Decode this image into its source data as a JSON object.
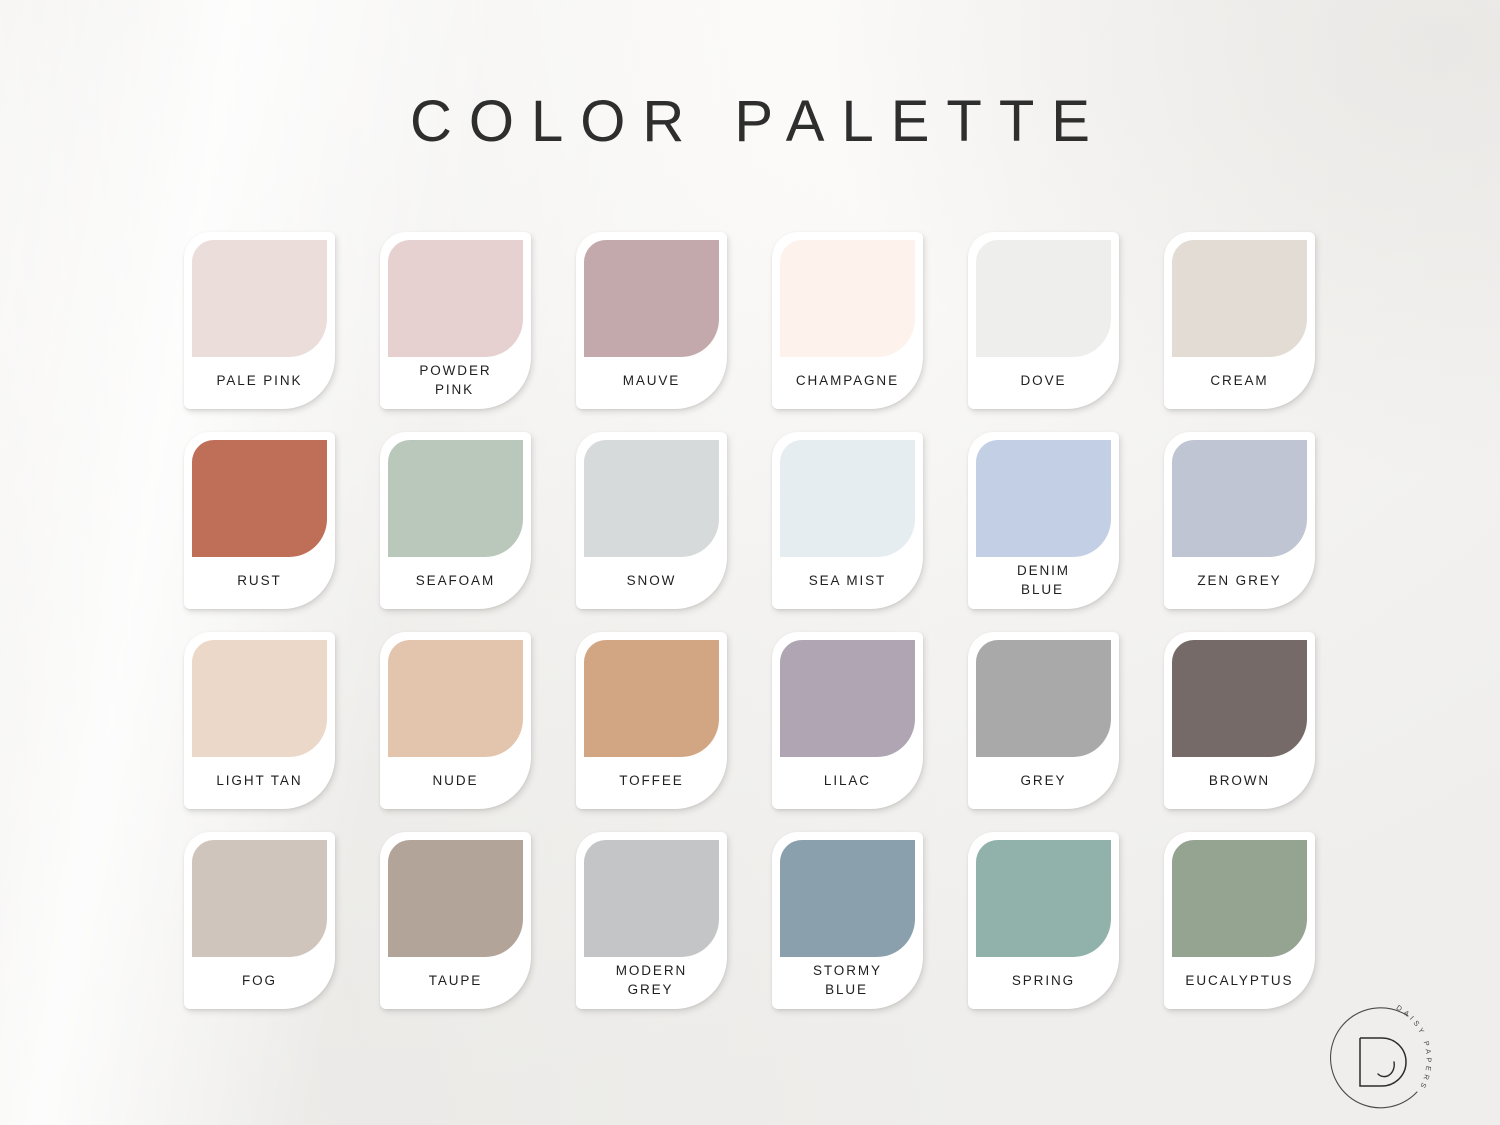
{
  "page": {
    "title": "COLOR PALETTE",
    "background_color": "#f4f3f1"
  },
  "brand": {
    "logo_monogram": "D",
    "logo_text": "DAISY PAPERS",
    "logo_text_letters": [
      "D",
      "A",
      "I",
      "S",
      "Y",
      " ",
      "P",
      "A",
      "P",
      "E",
      "R",
      "S"
    ],
    "logo_color": "#3a3a3a"
  },
  "palette": {
    "columns": 6,
    "rows": 4,
    "swatches": [
      {
        "name": "PALE PINK",
        "hex": "#eaddda"
      },
      {
        "name": "POWDER PINK",
        "hex": "#e6d0d0"
      },
      {
        "name": "MAUVE",
        "hex": "#c3a9ab"
      },
      {
        "name": "CHAMPAGNE",
        "hex": "#fdf2ec"
      },
      {
        "name": "DOVE",
        "hex": "#eeeeec"
      },
      {
        "name": "CREAM",
        "hex": "#e2dcd4"
      },
      {
        "name": "RUST",
        "hex": "#bf6f58"
      },
      {
        "name": "SEAFOAM",
        "hex": "#b9c8ba"
      },
      {
        "name": "SNOW",
        "hex": "#d7dada"
      },
      {
        "name": "SEA MIST",
        "hex": "#e5edf1"
      },
      {
        "name": "DENIM BLUE",
        "hex": "#c3cfe4"
      },
      {
        "name": "ZEN GREY",
        "hex": "#bfc5d2"
      },
      {
        "name": "LIGHT TAN",
        "hex": "#ecd8c9"
      },
      {
        "name": "NUDE",
        "hex": "#e3c4ad"
      },
      {
        "name": "TOFFEE",
        "hex": "#d3a683"
      },
      {
        "name": "LILAC",
        "hex": "#b0a5b3"
      },
      {
        "name": "GREY",
        "hex": "#a9a9a9"
      },
      {
        "name": "BROWN",
        "hex": "#756a68"
      },
      {
        "name": "FOG",
        "hex": "#cfc5bd"
      },
      {
        "name": "TAUPE",
        "hex": "#b3a499"
      },
      {
        "name": "MODERN GREY",
        "hex": "#c4c5c6"
      },
      {
        "name": "STORMY BLUE",
        "hex": "#8ba0ad"
      },
      {
        "name": "SPRING",
        "hex": "#91b2ab"
      },
      {
        "name": "EUCALYPTUS",
        "hex": "#95a391"
      }
    ]
  }
}
